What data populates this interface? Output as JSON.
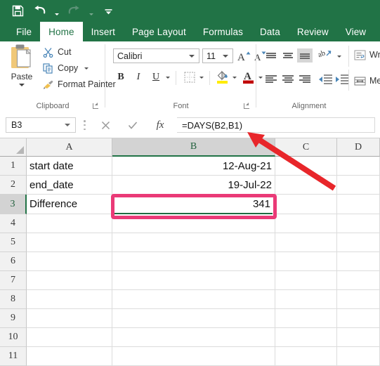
{
  "quick_access": {
    "save_label": "Save",
    "undo_label": "Undo",
    "redo_label": "Redo",
    "customize_label": "Customize Quick Access Toolbar"
  },
  "ribbon": {
    "tabs": [
      {
        "label": "File",
        "active": false
      },
      {
        "label": "Home",
        "active": true
      },
      {
        "label": "Insert",
        "active": false
      },
      {
        "label": "Page Layout",
        "active": false
      },
      {
        "label": "Formulas",
        "active": false
      },
      {
        "label": "Data",
        "active": false
      },
      {
        "label": "Review",
        "active": false
      },
      {
        "label": "View",
        "active": false
      }
    ],
    "clipboard": {
      "group_label": "Clipboard",
      "paste_label": "Paste",
      "cut_label": "Cut",
      "copy_label": "Copy",
      "format_painter_label": "Format Painter"
    },
    "font": {
      "group_label": "Font",
      "font_name": "Calibri",
      "font_size": "11",
      "grow_font_label": "A",
      "shrink_font_label": "A",
      "bold_label": "B",
      "italic_label": "I",
      "underline_label": "U",
      "borders_label": "Borders",
      "fill_color_label": "Fill Color",
      "font_color_label": "Font Color",
      "fill_color": "#ffec00",
      "font_color": "#c00000"
    },
    "alignment": {
      "group_label": "Alignment",
      "wrap_text_label": "Wra",
      "merge_center_label": "Mer",
      "orientation_label": "Orientation",
      "decrease_indent_label": "Decrease Indent",
      "increase_indent_label": "Increase Indent"
    }
  },
  "formula_bar": {
    "name_box_value": "B3",
    "cancel_label": "✕",
    "enter_label": "✓",
    "insert_function_label": "fx",
    "formula_value": "=DAYS(B2,B1)"
  },
  "sheet": {
    "columns": [
      {
        "label": "A",
        "active": false
      },
      {
        "label": "B",
        "active": true
      },
      {
        "label": "C",
        "active": false
      },
      {
        "label": "D",
        "active": false
      }
    ],
    "rows": [
      {
        "label": "1",
        "active": false,
        "a": "start date",
        "b": "12-Aug-21"
      },
      {
        "label": "2",
        "active": false,
        "a": "end_date",
        "b": "19-Jul-22"
      },
      {
        "label": "3",
        "active": true,
        "a": "Difference",
        "b": "341"
      },
      {
        "label": "4",
        "active": false,
        "a": "",
        "b": ""
      },
      {
        "label": "5",
        "active": false,
        "a": "",
        "b": ""
      },
      {
        "label": "6",
        "active": false,
        "a": "",
        "b": ""
      },
      {
        "label": "7",
        "active": false,
        "a": "",
        "b": ""
      },
      {
        "label": "8",
        "active": false,
        "a": "",
        "b": ""
      },
      {
        "label": "9",
        "active": false,
        "a": "",
        "b": ""
      },
      {
        "label": "10",
        "active": false,
        "a": "",
        "b": ""
      },
      {
        "label": "11",
        "active": false,
        "a": "",
        "b": ""
      }
    ],
    "selected_cell": "B3",
    "selected_cell_value": "341"
  },
  "annotations": {
    "highlight_color": "#ea3a77",
    "arrow_color": "#e8262a",
    "highlight_target": "B3",
    "arrow_target": "formula-bar"
  }
}
